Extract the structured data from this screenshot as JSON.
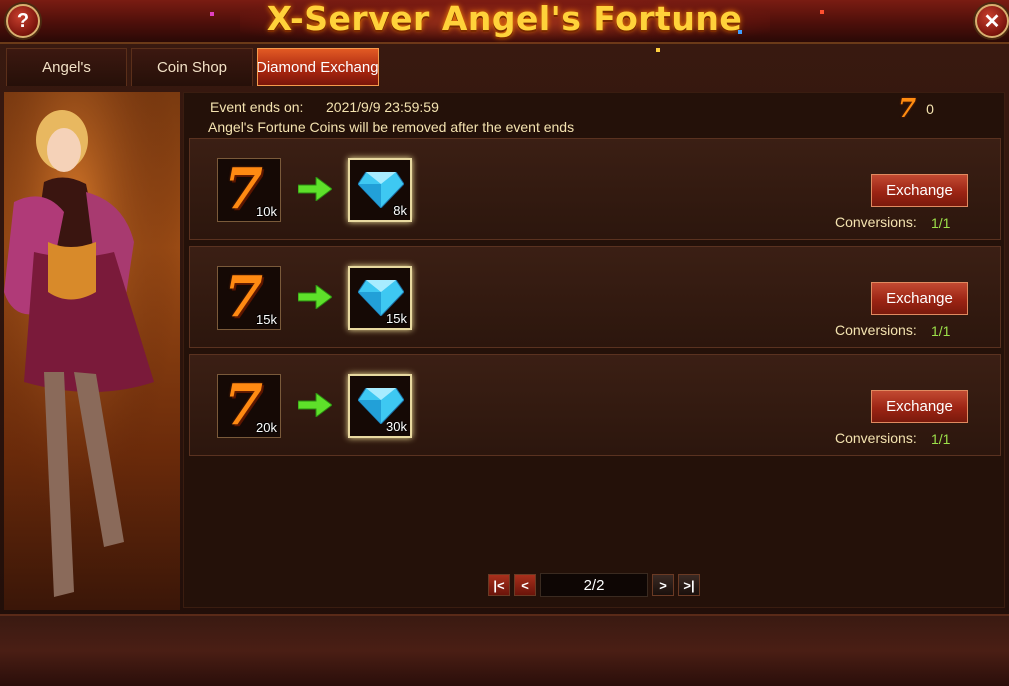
{
  "window": {
    "title": "X-Server Angel's Fortune",
    "help_label": "?",
    "close_label": "✕"
  },
  "tabs": [
    {
      "label": "Angel's Fortune",
      "active": false
    },
    {
      "label": "Coin Shop",
      "active": false
    },
    {
      "label": "Diamond Exchange",
      "active": true
    }
  ],
  "event": {
    "ends_label": "Event ends on:",
    "ends_date": "2021/9/9 23:59:59",
    "note": "Angel's Fortune Coins will be removed after the event ends"
  },
  "coin_balance": {
    "icon": "lucky-seven-coin-icon",
    "value": "0"
  },
  "exchanges": [
    {
      "coin_qty": "10k",
      "diamond_qty": "8k",
      "button": "Exchange",
      "conversions_label": "Conversions:",
      "conversions": "1/1"
    },
    {
      "coin_qty": "15k",
      "diamond_qty": "15k",
      "button": "Exchange",
      "conversions_label": "Conversions:",
      "conversions": "1/1"
    },
    {
      "coin_qty": "20k",
      "diamond_qty": "30k",
      "button": "Exchange",
      "conversions_label": "Conversions:",
      "conversions": "1/1"
    }
  ],
  "item_glyphs": {
    "coin": "7"
  },
  "pagination": {
    "current": "2/2",
    "first_label": "|<",
    "prev_label": "<",
    "next_label": ">",
    "last_label": ">|"
  },
  "colors": {
    "title": "#ffd23a",
    "accent_button": "#9c2414",
    "conversions": "#9ce04a",
    "coin": "#ff8a12",
    "diamond": "#3ec8f2"
  }
}
